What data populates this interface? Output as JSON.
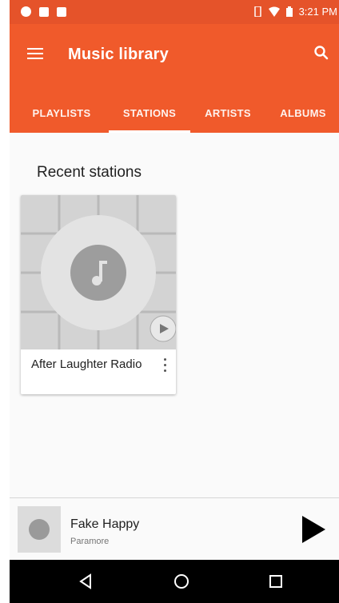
{
  "status_bar": {
    "time": "3:21 PM"
  },
  "app_bar": {
    "title": "Music library"
  },
  "tabs": [
    {
      "label": "PLAYLISTS",
      "active": false
    },
    {
      "label": "STATIONS",
      "active": true
    },
    {
      "label": "ARTISTS",
      "active": false
    },
    {
      "label": "ALBUMS",
      "active": false
    }
  ],
  "content": {
    "section_title": "Recent stations",
    "stations": [
      {
        "title": "After Laughter Radio"
      }
    ]
  },
  "player": {
    "song": "Fake Happy",
    "artist": "Paramore"
  },
  "colors": {
    "accent": "#f05a2b",
    "status": "#e5532a",
    "navbar": "#000000"
  },
  "icons": [
    "menu-icon",
    "search-icon",
    "music-note-icon",
    "play-icon",
    "more-vert-icon",
    "back-icon",
    "home-icon",
    "recents-icon"
  ]
}
